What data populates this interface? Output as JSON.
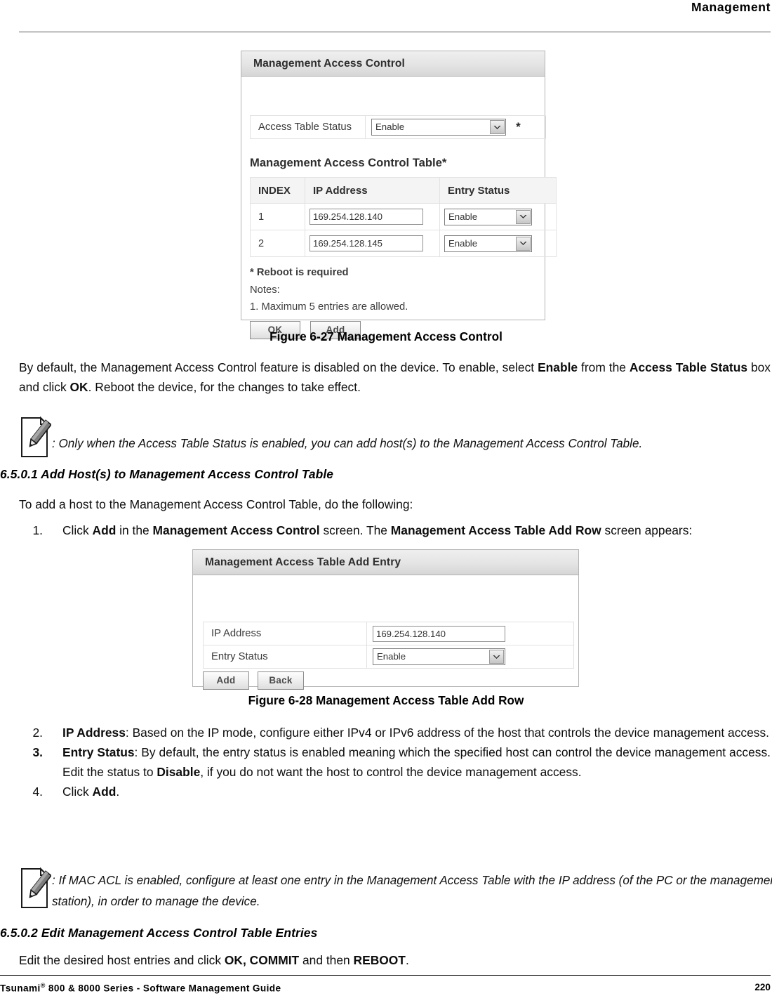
{
  "header": {
    "title": "Management"
  },
  "figure1": {
    "panel_title": "Management Access Control",
    "access_table_status_label": "Access Table Status",
    "access_table_status_value": "Enable",
    "required_marker": "*",
    "table_title": "Management Access Control Table*",
    "columns": [
      "INDEX",
      "IP Address",
      "Entry Status"
    ],
    "rows": [
      {
        "index": "1",
        "ip": "169.254.128.140",
        "status": "Enable"
      },
      {
        "index": "2",
        "ip": "169.254.128.145",
        "status": "Enable"
      }
    ],
    "reboot_note": "* Reboot is required",
    "notes_label": "Notes:",
    "note_1": "1. Maximum 5 entries are allowed.",
    "ok_button": "OK",
    "add_button": "Add",
    "caption": "Figure 6-27 Management Access Control"
  },
  "paragraph1": {
    "part1": "By default, the Management Access Control feature is disabled on the device. To enable, select ",
    "bold1": "Enable",
    "part2": " from the ",
    "bold2": "Access Table Status",
    "part3": " box and click ",
    "bold3": "OK",
    "part4": ". Reboot the device, for the changes to take effect."
  },
  "note1": {
    "icon": "note-pencil-icon",
    "text": ": Only when the Access Table Status is enabled, you can add host(s) to the Management Access Control Table."
  },
  "section1": {
    "heading": "6.5.0.1 Add Host(s) to Management Access Control Table",
    "intro": "To add a host to the Management Access Control Table, do the following:",
    "item1": {
      "num": "1.",
      "part1": "Click ",
      "bold1": "Add",
      "part2": " in the ",
      "bold2": "Management Access Control",
      "part3": " screen. The ",
      "bold3": "Management Access Table Add Row",
      "part4": " screen appears:"
    }
  },
  "figure2": {
    "panel_title": "Management Access Table Add Entry",
    "ip_label": "IP Address",
    "ip_value": "169.254.128.140",
    "status_label": "Entry Status",
    "status_value": "Enable",
    "add_button": "Add",
    "back_button": "Back",
    "caption": "Figure 6-28 Management Access Table Add Row"
  },
  "steps": [
    {
      "num": "2.",
      "num_bold": false,
      "bold1": "IP Address",
      "text1": ": Based on the IP mode, configure either IPv4 or IPv6 address of the host that controls the device management access."
    },
    {
      "num": "3.",
      "num_bold": true,
      "bold1": "Entry Status",
      "text1": ": By default, the entry status is enabled meaning which the specified host can control the device management access. Edit the status to ",
      "bold2": "Disable",
      "text2": ", if you do not want the host to control the device management access."
    },
    {
      "num": "4.",
      "num_bold": false,
      "text1": "Click ",
      "bold1": "Add",
      "text2": "."
    }
  ],
  "note2": {
    "icon": "note-pencil-icon",
    "text": ": If MAC ACL is enabled, configure at least one entry in the Management Access Table with the IP address (of the PC or the management station), in order to manage the device."
  },
  "section2": {
    "heading": "6.5.0.2 Edit Management Access Control Table Entries",
    "part1": "Edit the desired host entries and click ",
    "bold1": "OK, COMMIT",
    "part2": " and then ",
    "bold2": "REBOOT",
    "part3": "."
  },
  "footer": {
    "left_prefix": "Tsunami",
    "left_sup": "®",
    "left_rest": " 800 & 8000 Series - Software Management Guide",
    "page_number": "220"
  }
}
